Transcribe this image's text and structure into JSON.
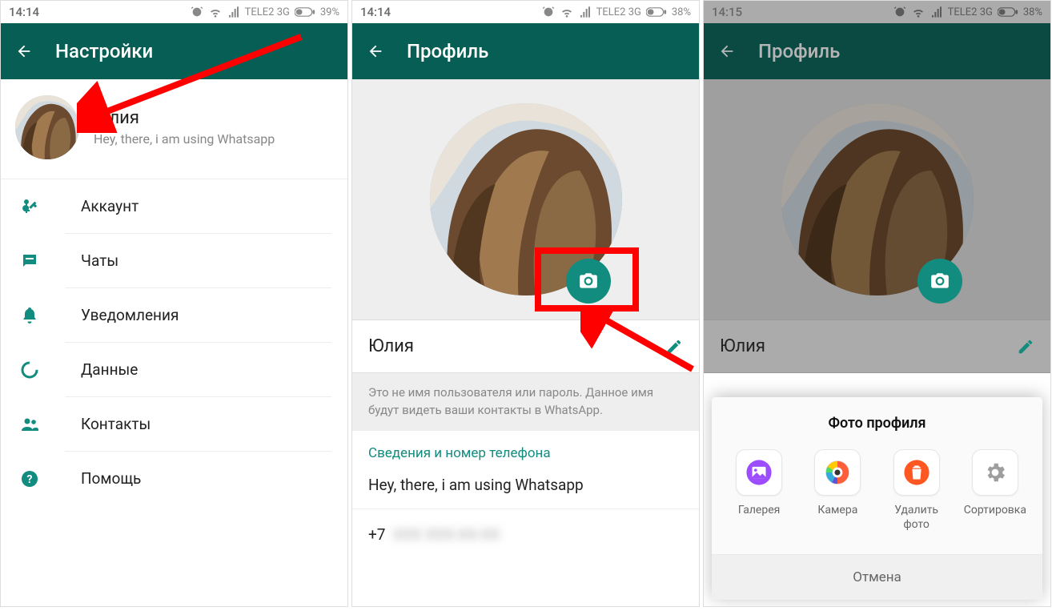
{
  "statusbar": {
    "s1": {
      "time": "14:14",
      "carrier": "TELE2 3G",
      "battery": "39%"
    },
    "s2": {
      "time": "14:14",
      "carrier": "TELE2 3G",
      "battery": "38%"
    },
    "s3": {
      "time": "14:15",
      "carrier": "TELE2 3G",
      "battery": "38%"
    }
  },
  "screen1": {
    "title": "Настройки",
    "profile": {
      "name": "Юлия",
      "status": "Hey, there, i am using Whatsapp"
    },
    "items": {
      "account": "Аккаунт",
      "chats": "Чаты",
      "notifications": "Уведомления",
      "data": "Данные",
      "contacts": "Контакты",
      "help": "Помощь"
    }
  },
  "screen2": {
    "title": "Профиль",
    "name": "Юлия",
    "hint": "Это не имя пользователя или пароль. Данное имя будут видеть ваши контакты в WhatsApp.",
    "section": "Сведения и номер телефона",
    "about": "Hey, there, i am using Whatsapp",
    "phone_prefix": "+7"
  },
  "screen3": {
    "title": "Профиль",
    "name": "Юлия",
    "sheet": {
      "title": "Фото профиля",
      "options": {
        "gallery": "Галерея",
        "camera": "Камера",
        "delete": "Удалить фото",
        "sort": "Сортировка"
      },
      "cancel": "Отмена"
    }
  }
}
